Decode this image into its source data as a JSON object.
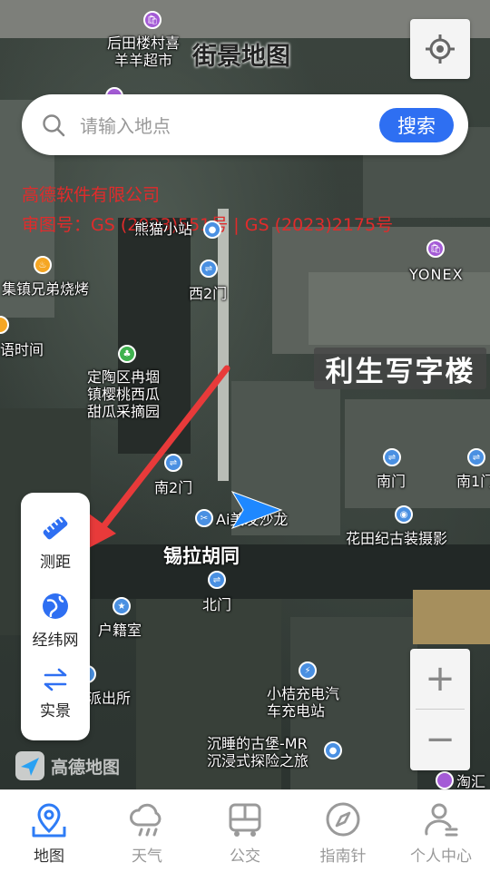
{
  "map": {
    "title": "街景地图",
    "copyright_line1": "高德软件有限公司",
    "copyright_line2": "审图号：GS (2023)551号 | GS (2023)2175号",
    "logo_text": "高德地图",
    "building_label": "利生写字楼",
    "street_label": "锡拉胡同",
    "pois": {
      "p1": "后田楼村喜\n羊羊超市",
      "p2": "熊猫小站",
      "p3": "西2门",
      "p4": "YONEX",
      "p5": "集镇兄弟烧烤",
      "p6": "语时间",
      "p7": "定陶区冉堌\n镇樱桃西瓜\n甜瓜采摘园",
      "p8": "南2门",
      "p9": "Ai美发沙龙",
      "p10": "南门",
      "p11": "南1门",
      "p12": "花田纪古装摄影",
      "p13": "北门",
      "p14": "户籍室",
      "p15": "派出所",
      "p16": "小桔充电汽\n车充电站",
      "p17": "沉睡的古堡-MR\n沉浸式探险之旅",
      "p18": "淘汇"
    }
  },
  "search": {
    "placeholder": "请输入地点",
    "button_label": "搜索"
  },
  "tools": [
    {
      "label": "测距",
      "icon": "ruler-icon"
    },
    {
      "label": "经纬网",
      "icon": "globe-icon"
    },
    {
      "label": "实景",
      "icon": "swap-arrows-icon"
    }
  ],
  "zoom": {
    "in": "+",
    "out": "−"
  },
  "nav": [
    {
      "label": "地图",
      "icon": "map-pin-icon",
      "active": true
    },
    {
      "label": "天气",
      "icon": "cloud-rain-icon"
    },
    {
      "label": "公交",
      "icon": "bus-icon"
    },
    {
      "label": "指南针",
      "icon": "compass-icon"
    },
    {
      "label": "个人中心",
      "icon": "user-icon"
    }
  ],
  "colors": {
    "accent": "#2e6ff2",
    "copyright_red": "#e12b2b",
    "annotation_arrow": "#e83a3a",
    "nav_active": "#2e7cf6",
    "nav_inactive": "#9a9a9a"
  }
}
